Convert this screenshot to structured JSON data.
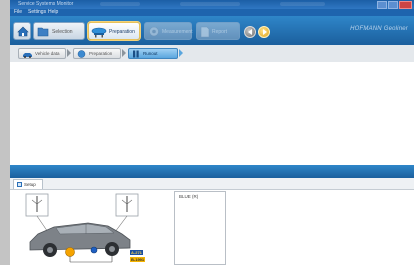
{
  "window": {
    "title": "Service Systems Monitor"
  },
  "menu": {
    "items": [
      "File",
      "Settings",
      "Help"
    ]
  },
  "toolbar": {
    "buttons": [
      {
        "label": "",
        "state": "normal",
        "icon": "home-icon"
      },
      {
        "label": "Selection",
        "state": "normal",
        "icon": "folder-icon"
      },
      {
        "label": "Preparation",
        "state": "active",
        "icon": "lift-icon"
      },
      {
        "label": "Measurement",
        "state": "disabled",
        "icon": "wheel-icon"
      },
      {
        "label": "Report",
        "state": "disabled",
        "icon": "document-icon"
      }
    ],
    "nav": {
      "back_icon": "back-arrow-icon",
      "forward_icon": "forward-arrow-icon"
    },
    "brand": "HOFMANN Geoliner"
  },
  "breadcrumb": {
    "items": [
      {
        "label": "Vehicle data",
        "active": false,
        "icon": "vehicle-icon"
      },
      {
        "label": "Preparation",
        "active": false,
        "icon": "wrench-icon"
      },
      {
        "label": "Runout",
        "active": true,
        "icon": "wheel-icon"
      }
    ]
  },
  "lower": {
    "tab": {
      "label": "Setup"
    },
    "panel_label": "BLUE (R)",
    "tags": {
      "blue": "A-271",
      "orange": "B-1991"
    }
  },
  "colors": {
    "titlebar": "#1c5fa6",
    "toolbar": "#2f86c9",
    "accent_active": "#5aa6de",
    "car_body": "#7d8288",
    "sensor_orange": "#f5a300",
    "sensor_blue": "#1e5fc2",
    "tag_blue_bg": "#1b4fa0",
    "tag_orange_bg": "#f5b400"
  }
}
